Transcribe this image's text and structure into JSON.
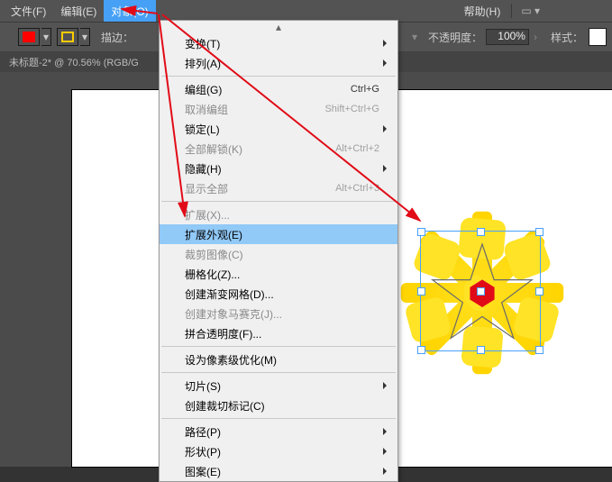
{
  "menubar": {
    "file": "文件(F)",
    "edit": "编辑(E)",
    "object": "对象(O)",
    "help": "帮助(H)"
  },
  "toolbar": {
    "stroke_label": "描边：",
    "opacity_label": "不透明度：",
    "opacity_value": "100%",
    "style_label": "样式：",
    "fill_color": "#ff0000",
    "stroke_color": "#ffcc00"
  },
  "doc_tab": "未标题-2* @ 70.56% (RGB/G",
  "menu": {
    "items": [
      {
        "type": "scrollup"
      },
      {
        "label": "变换(T)",
        "sub": true
      },
      {
        "label": "排列(A)",
        "sub": true
      },
      {
        "type": "sep"
      },
      {
        "label": "编组(G)",
        "shortcut": "Ctrl+G"
      },
      {
        "label": "取消编组",
        "shortcut": "Shift+Ctrl+G",
        "disabled": true
      },
      {
        "label": "锁定(L)",
        "sub": true
      },
      {
        "label": "全部解锁(K)",
        "shortcut": "Alt+Ctrl+2",
        "disabled": true
      },
      {
        "label": "隐藏(H)",
        "sub": true
      },
      {
        "label": "显示全部",
        "shortcut": "Alt+Ctrl+3",
        "disabled": true
      },
      {
        "type": "sep"
      },
      {
        "label": "扩展(X)...",
        "disabled": true
      },
      {
        "label": "扩展外观(E)",
        "highlight": true
      },
      {
        "label": "裁剪图像(C)",
        "disabled": true
      },
      {
        "label": "栅格化(Z)..."
      },
      {
        "label": "创建渐变网格(D)..."
      },
      {
        "label": "创建对象马赛克(J)...",
        "disabled": true
      },
      {
        "label": "拼合透明度(F)..."
      },
      {
        "type": "sep"
      },
      {
        "label": "设为像素级优化(M)"
      },
      {
        "type": "sep"
      },
      {
        "label": "切片(S)",
        "sub": true
      },
      {
        "label": "创建裁切标记(C)"
      },
      {
        "type": "sep"
      },
      {
        "label": "路径(P)",
        "sub": true
      },
      {
        "label": "形状(P)",
        "sub": true
      },
      {
        "label": "图案(E)",
        "sub": true
      }
    ]
  },
  "chart_data": null
}
